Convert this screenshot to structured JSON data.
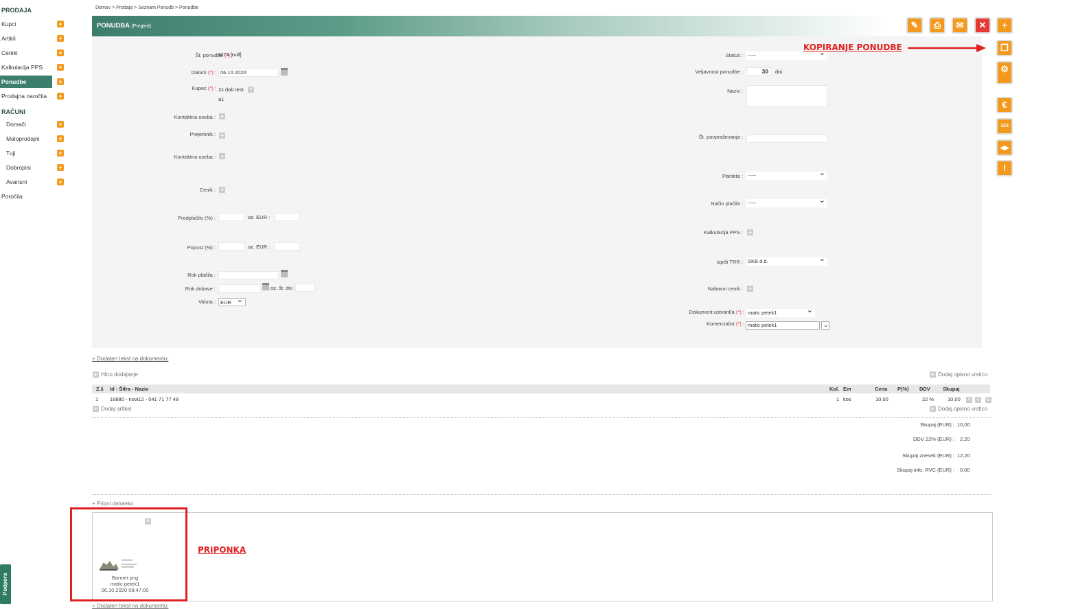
{
  "sidebar": {
    "sections": [
      {
        "title": "PRODAJA",
        "items": [
          "Kupci",
          "Artikli",
          "Ceniki",
          "Kalkulacija PPS",
          "Ponudbe",
          "Prodajna naročila"
        ]
      },
      {
        "title": "RAČUNI",
        "items": [
          "Domači",
          "Maloprodajni",
          "Tuji",
          "Dobropisi",
          "Avansni"
        ]
      }
    ],
    "footer_item": "Poročila",
    "support": "Podpora"
  },
  "breadcrumb": "Domov  >  Prodaja  >  Seznam Ponudb  >  Ponudbe",
  "header": {
    "title": "PONUDBA",
    "subtitle": "(Pregled)"
  },
  "form_left": {
    "st_ponudbe_label": "Št. ponudbe",
    "st_ponudbe_value": "4274 [null]",
    "datum_label": "Datum",
    "datum_value": "06.10.2020",
    "kupec_label": "Kupec",
    "kupec_value": "2x dob test",
    "kupec_value2": "a1",
    "kontaktna_oseba_label": "Kontaktna oseba :",
    "prejemnik_label": "Prejemnik :",
    "kontaktna_oseba2_label": "Kontaktna oseba :",
    "cenik_label": "Cenik :",
    "predplacilo_label": "Predplačilo (%) :",
    "popust_label": "Popust (%) :",
    "oz_eur_label": "oz. EUR :",
    "rok_placila_label": "Rok plačila :",
    "rok_dobave_label": "Rok dobave :",
    "oz_st_dni_label": "oz. št. dni",
    "valuta_label": "Valuta :",
    "valuta_value": "EUR",
    "req_mark": "(*)"
  },
  "form_right": {
    "status_label": "Status :",
    "status_value": "-----",
    "veljavnost_label": "Veljavnost ponudbe :",
    "veljavnost_value": "30",
    "veljavnost_unit": "dni",
    "naziv_label": "Naziv :",
    "st_povprasevanja_label": "Št. povpraševanja :",
    "pariteta_label": "Pariteta :",
    "pariteta_value": "-----",
    "nacin_placila_label": "Način plačila :",
    "nacin_placila_value": "-----",
    "kalkulacija_label": "Kalkulacija PPS :",
    "izpisi_trr_label": "Izpiši TRR :",
    "izpisi_trr_value": "SKB d.d.",
    "nabavni_cenik_label": "Nabavni cenik :",
    "dokument_label": "Dokument ustvaril/a",
    "dokument_value": "matic petek1",
    "komercialist_label": "Komercialist",
    "komercialist_value": "matic petek1"
  },
  "links": {
    "dodaten_tekst": "+ Dodaten tekst na dokumentu:",
    "hitro_dodajanje": "Hitro dodajanje",
    "dodaj_opisno": "Dodaj opisno vrstico",
    "dodaj_artikel": "Dodaj artikel",
    "dodaj_opisno2": "Dodaj opisno vrstico",
    "pripni": "+ Pripni datoteko",
    "dodaten_tekst2": "+ Dodaten tekst na dokumentu:"
  },
  "table": {
    "headers": [
      "Z.š",
      "Id - Šifra - Naziv",
      "Kol.",
      "Em",
      "Cena",
      "P(%)",
      "DDV",
      "Skupaj"
    ],
    "row": [
      "1",
      "16880 - novi12 - 041 71 77 48",
      "1",
      "kos",
      "10,00",
      "",
      "22 %",
      "10,00"
    ]
  },
  "totals": [
    {
      "label": "Skupaj (EUR) :",
      "value": "10,00"
    },
    {
      "label": "DDV 22% (EUR) :",
      "value": "2,20"
    },
    {
      "label": "Skupaj znesek (EUR) :",
      "value": "12,20"
    },
    {
      "label": "Skupaj info. RVC (EUR) :",
      "value": "0,00"
    }
  ],
  "attachment": {
    "filename": "Banner.png",
    "user": "matic petek1",
    "datetime": "06.10.2020 09:47:00"
  },
  "annotations": {
    "copy": "KOPIRANJE PONUDBE",
    "attachment": "PRIPONKA"
  },
  "colors": {
    "brand": "#3d7f6c",
    "accent": "#f39a1e",
    "danger": "#e53935",
    "annotation": "#e02020"
  },
  "icons": [
    "edit-icon",
    "print-icon",
    "mail-icon",
    "close-icon",
    "add-icon",
    "copy-icon",
    "settings-icon",
    "euro-icon",
    "numbering-icon",
    "split-icon",
    "warning-icon"
  ]
}
